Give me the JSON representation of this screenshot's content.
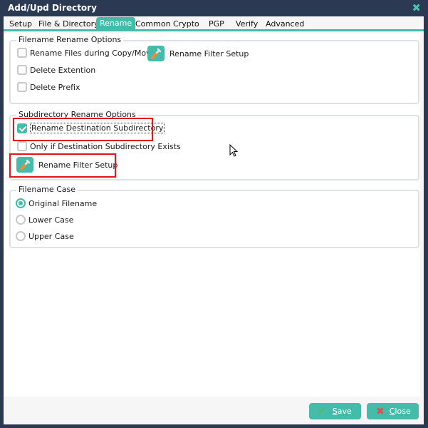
{
  "window": {
    "title": "Add/Upd Directory",
    "close_icon": "close-icon"
  },
  "tabs": [
    {
      "label": "Setup",
      "active": false
    },
    {
      "label": "File & Directory",
      "active": false
    },
    {
      "label": "Rename",
      "active": true
    },
    {
      "label": "Common",
      "active": false
    },
    {
      "label": "Crypto",
      "active": false
    },
    {
      "label": "PGP",
      "active": false
    },
    {
      "label": "Verify",
      "active": false
    },
    {
      "label": "Advanced",
      "active": false
    }
  ],
  "filename_rename": {
    "legend": "Filename Rename Options",
    "rename_files": {
      "label": "Rename Files during Copy/Move",
      "checked": false
    },
    "filter_button": {
      "label": "Rename Filter Setup",
      "icon": "wrench-icon"
    },
    "delete_extension": {
      "label": "Delete Extention",
      "checked": false
    },
    "delete_prefix": {
      "label": "Delete Prefix",
      "checked": false
    }
  },
  "subdir_rename": {
    "legend": "Subdirectory Rename Options",
    "rename_dest": {
      "label": "Rename Destination Subdirectory",
      "checked": true
    },
    "only_if_exists": {
      "label": "Only if Destination Subdirectory Exists",
      "checked": false
    },
    "filter_button": {
      "label": "Rename Filter Setup",
      "icon": "wrench-icon"
    }
  },
  "filename_case": {
    "legend": "Filename Case",
    "options": [
      {
        "label": "Original Filename",
        "selected": true
      },
      {
        "label": "Lower Case",
        "selected": false
      },
      {
        "label": "Upper Case",
        "selected": false
      }
    ]
  },
  "footer": {
    "save": {
      "label_first": "S",
      "label_rest": "ave",
      "icon": "checkmark-icon"
    },
    "close": {
      "label_first": "C",
      "label_rest": "lose",
      "icon": "x-icon"
    }
  },
  "colors": {
    "accent": "#45bcaa",
    "titlebar": "#2b3a52",
    "highlight": "#e0161b"
  }
}
